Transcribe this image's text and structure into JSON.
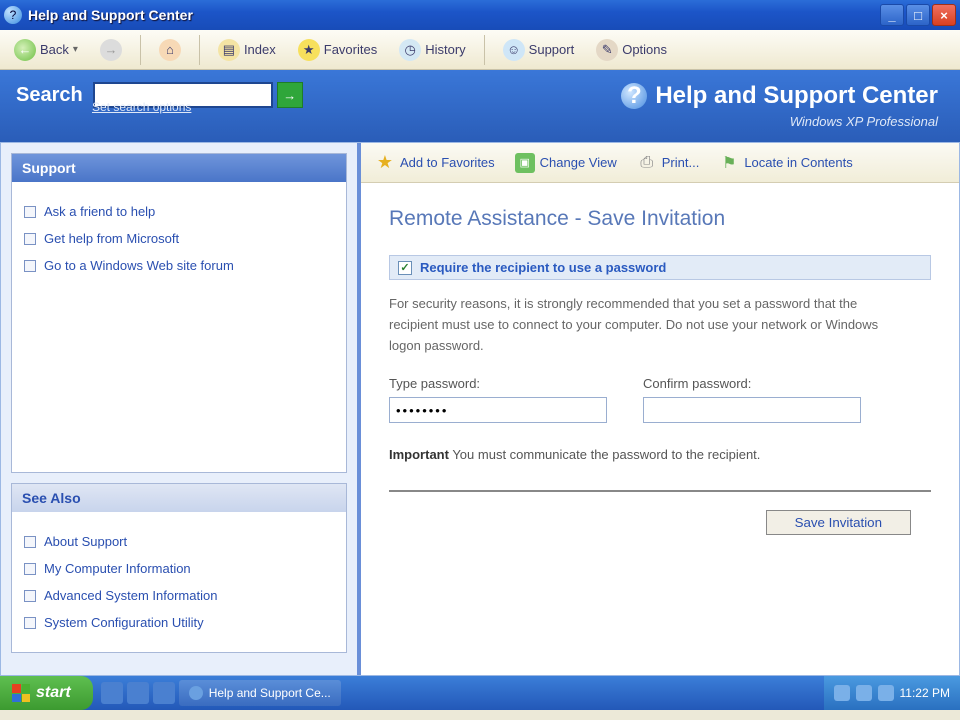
{
  "window": {
    "title": "Help and Support Center"
  },
  "toolbar": {
    "back": "Back",
    "index": "Index",
    "favorites": "Favorites",
    "history": "History",
    "support": "Support",
    "options": "Options"
  },
  "header": {
    "search_label": "Search",
    "set_options": "Set search options",
    "title": "Help and Support Center",
    "subtitle": "Windows XP Professional"
  },
  "sidebar": {
    "support_header": "Support",
    "support_links": [
      "Ask a friend to help",
      "Get help from Microsoft",
      "Go to a Windows Web site forum"
    ],
    "seealso_header": "See Also",
    "seealso_links": [
      "About Support",
      "My Computer Information",
      "Advanced System Information",
      "System Configuration Utility"
    ]
  },
  "content_toolbar": {
    "add_fav": "Add to Favorites",
    "change_view": "Change View",
    "print": "Print...",
    "locate": "Locate in Contents"
  },
  "page": {
    "title": "Remote Assistance - Save Invitation",
    "checkbox_label": "Require the recipient to use a password",
    "description": "For security reasons, it is strongly recommended that you set a password that the recipient must use to connect to your computer. Do not use your network or Windows logon password.",
    "type_pw_label": "Type password:",
    "confirm_pw_label": "Confirm password:",
    "pw_value": "••••••••",
    "confirm_value": "",
    "important_prefix": "Important",
    "important_text": " You must communicate the password to the recipient.",
    "save_btn": "Save Invitation"
  },
  "taskbar": {
    "start": "start",
    "task_item": "Help and Support Ce...",
    "clock": "11:22 PM"
  }
}
